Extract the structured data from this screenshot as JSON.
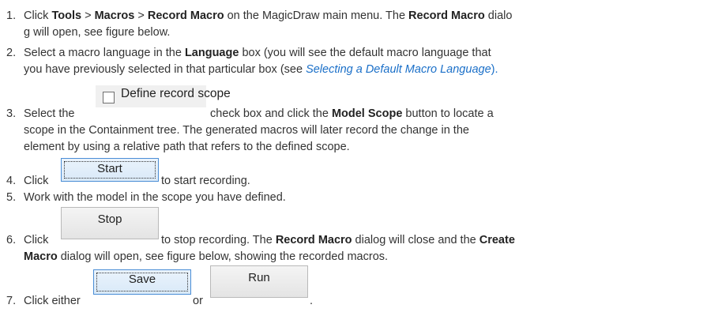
{
  "steps": [
    {
      "num": "1.",
      "l1_a": "Click ",
      "l1_b": "Tools",
      "l1_c": " > ",
      "l1_d": "Macros",
      "l1_e": " > ",
      "l1_f": "Record Macro",
      "l1_g": " on the MagicDraw main menu. The ",
      "l1_h": "Record Macro",
      "l1_i": " dialo",
      "l2": "g will open, see figure below."
    },
    {
      "num": "2.",
      "l1_a": "Select a macro language in the ",
      "l1_b": "Language",
      "l1_c": " box (you will see the default macro language that",
      "l2_a": "you have previously selected in that particular box (see ",
      "l2_link": "Selecting a Default Macro Language",
      "l2_b": ")."
    },
    {
      "num": "3.",
      "l1_a": "Select the",
      "checkbox_label": "Define record scope",
      "l1_b": " check box and click the ",
      "l1_c": "Model Scope",
      "l1_d": " button to locate a",
      "l2": "scope in the Containment tree. The generated macros will later record the change in the",
      "l3": "element by using a relative path that refers to the defined scope."
    },
    {
      "num": "4.",
      "l1_a": "Click",
      "button": "Start",
      "l1_b": " to start recording."
    },
    {
      "num": "5.",
      "l1": "Work with the model in the scope you have defined."
    },
    {
      "num": "6.",
      "l1_a": "Click",
      "button": "Stop",
      "l1_b": " to stop recording. The ",
      "l1_c": "Record Macro",
      "l1_d": " dialog will close and the ",
      "l1_e": "Create",
      "l2_a": "Macro",
      "l2_b": " dialog will open, see figure below, showing the recorded macros."
    },
    {
      "num": "7.",
      "l1_a": "Click either",
      "button1": "Save",
      "l1_b": " or ",
      "button2": "Run",
      "l1_c": "."
    }
  ]
}
